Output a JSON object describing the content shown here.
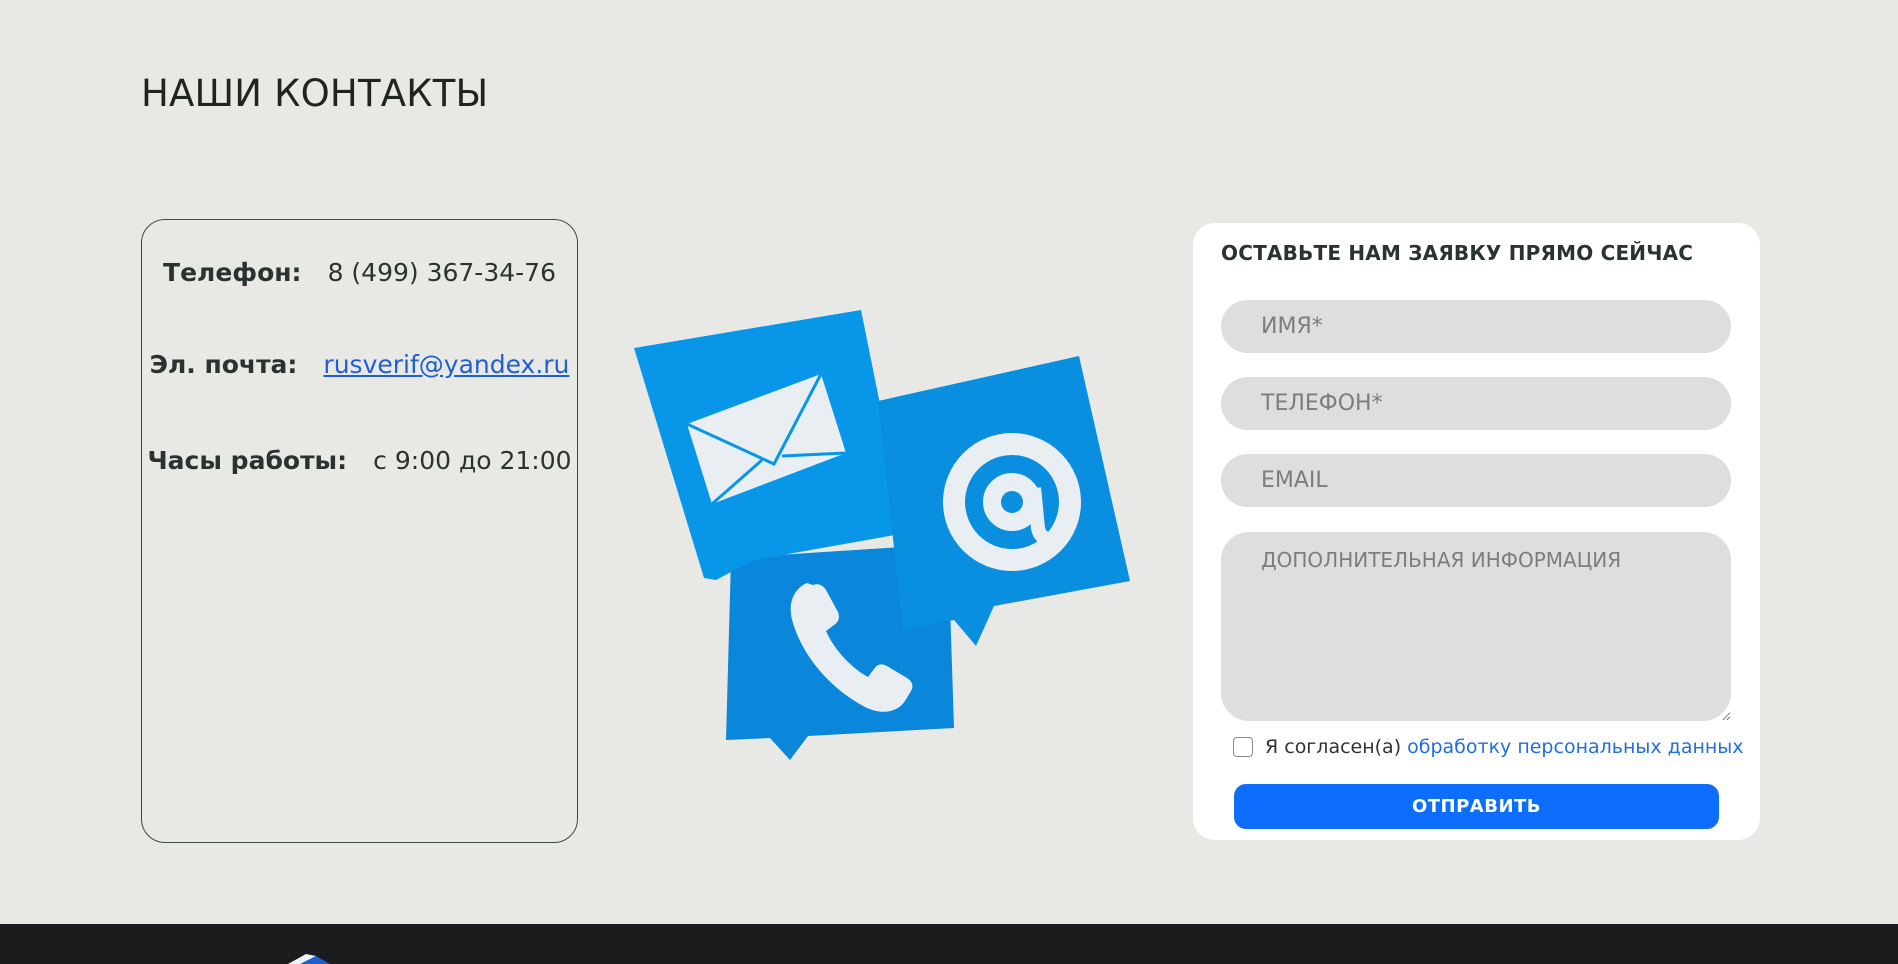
{
  "page": {
    "title": "НАШИ КОНТАКТЫ"
  },
  "contacts": {
    "phone_label": "Телефон:",
    "phone_value": "8 (499) 367-34-76",
    "email_label": "Эл. почта:",
    "email_value": "rusverif@yandex.ru",
    "hours_label": "Часы работы:",
    "hours_value": "с 9:00 до 21:00"
  },
  "form": {
    "title": "ОСТАВЬТЕ НАМ ЗАЯВКУ ПРЯМО СЕЙЧАС",
    "name_placeholder": "ИМЯ*",
    "phone_placeholder": "ТЕЛЕФОН*",
    "email_placeholder": "EMAIL",
    "info_placeholder": "ДОПОЛНИТЕЛЬНАЯ ИНФОРМАЦИЯ",
    "consent_text": "Я согласен(а)",
    "consent_link": "обработку персональных данных",
    "submit_label": "ОТПРАВИТЬ"
  },
  "colors": {
    "page_bg": "#e8e8e4",
    "accent": "#0d6efd",
    "icon_blue": "#0a8fe0",
    "footer_bg": "#1b1c1e"
  },
  "icons": [
    "envelope-icon",
    "at-sign-icon",
    "phone-handset-icon"
  ]
}
